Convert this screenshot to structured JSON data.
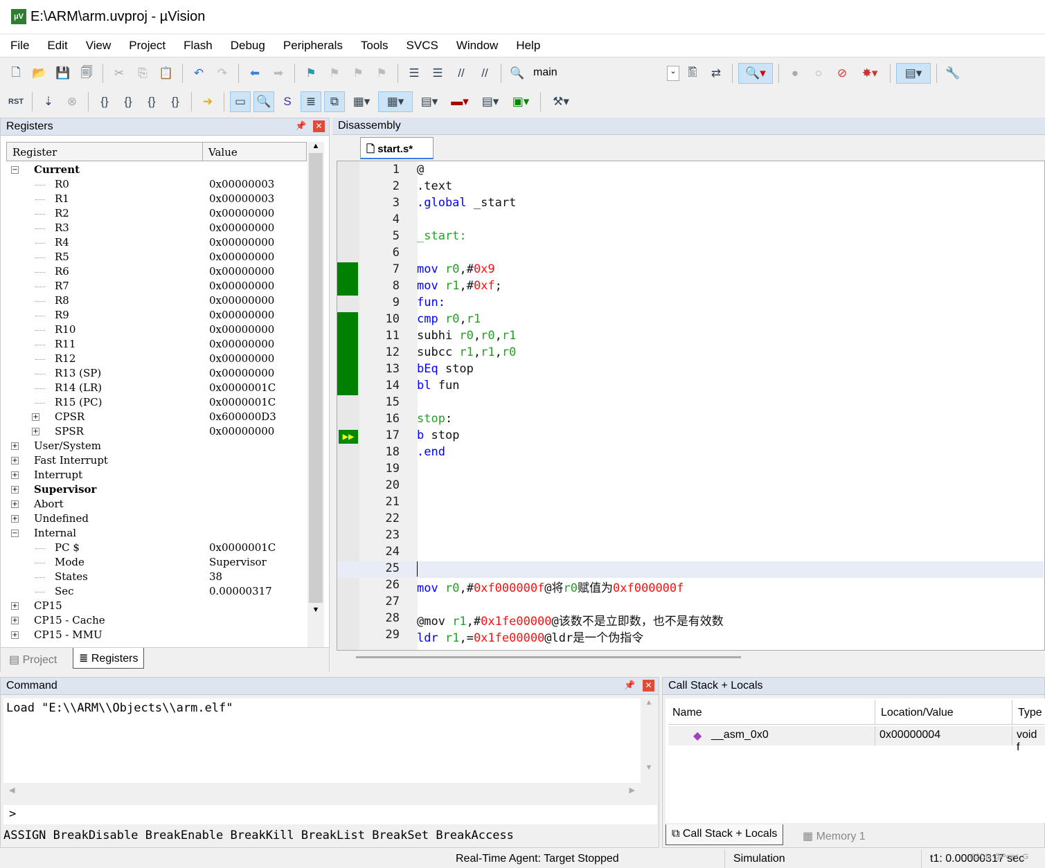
{
  "window": {
    "title": "E:\\ARM\\arm.uvproj - µVision",
    "icon": "uvision-icon"
  },
  "menu": [
    "File",
    "Edit",
    "View",
    "Project",
    "Flash",
    "Debug",
    "Peripherals",
    "Tools",
    "SVCS",
    "Window",
    "Help"
  ],
  "toolbar1": {
    "target_combo": "main"
  },
  "toolbar2": {
    "reset_label": "RST"
  },
  "registers": {
    "title": "Registers",
    "col_register": "Register",
    "col_value": "Value",
    "rows": [
      {
        "name": "Current",
        "value": "",
        "level": 0,
        "exp": "-",
        "bold": true
      },
      {
        "name": "R0",
        "value": "0x00000003",
        "level": 1
      },
      {
        "name": "R1",
        "value": "0x00000003",
        "level": 1
      },
      {
        "name": "R2",
        "value": "0x00000000",
        "level": 1
      },
      {
        "name": "R3",
        "value": "0x00000000",
        "level": 1
      },
      {
        "name": "R4",
        "value": "0x00000000",
        "level": 1
      },
      {
        "name": "R5",
        "value": "0x00000000",
        "level": 1
      },
      {
        "name": "R6",
        "value": "0x00000000",
        "level": 1
      },
      {
        "name": "R7",
        "value": "0x00000000",
        "level": 1
      },
      {
        "name": "R8",
        "value": "0x00000000",
        "level": 1
      },
      {
        "name": "R9",
        "value": "0x00000000",
        "level": 1
      },
      {
        "name": "R10",
        "value": "0x00000000",
        "level": 1
      },
      {
        "name": "R11",
        "value": "0x00000000",
        "level": 1
      },
      {
        "name": "R12",
        "value": "0x00000000",
        "level": 1
      },
      {
        "name": "R13 (SP)",
        "value": "0x00000000",
        "level": 1
      },
      {
        "name": "R14 (LR)",
        "value": "0x0000001C",
        "level": 1
      },
      {
        "name": "R15 (PC)",
        "value": "0x0000001C",
        "level": 1
      },
      {
        "name": "CPSR",
        "value": "0x600000D3",
        "level": 1,
        "exp": "+"
      },
      {
        "name": "SPSR",
        "value": "0x00000000",
        "level": 1,
        "exp": "+"
      },
      {
        "name": "User/System",
        "value": "",
        "level": 0,
        "exp": "+"
      },
      {
        "name": "Fast Interrupt",
        "value": "",
        "level": 0,
        "exp": "+"
      },
      {
        "name": "Interrupt",
        "value": "",
        "level": 0,
        "exp": "+"
      },
      {
        "name": "Supervisor",
        "value": "",
        "level": 0,
        "exp": "+",
        "bold": true
      },
      {
        "name": "Abort",
        "value": "",
        "level": 0,
        "exp": "+"
      },
      {
        "name": "Undefined",
        "value": "",
        "level": 0,
        "exp": "+"
      },
      {
        "name": "Internal",
        "value": "",
        "level": 0,
        "exp": "-"
      },
      {
        "name": "PC  $",
        "value": "0x0000001C",
        "level": 1
      },
      {
        "name": "Mode",
        "value": "Supervisor",
        "level": 1
      },
      {
        "name": "States",
        "value": "38",
        "level": 1
      },
      {
        "name": "Sec",
        "value": "0.00000317",
        "level": 1
      },
      {
        "name": "CP15",
        "value": "",
        "level": 0,
        "exp": "+"
      },
      {
        "name": "CP15 - Cache",
        "value": "",
        "level": 0,
        "exp": "+"
      },
      {
        "name": "CP15 - MMU",
        "value": "",
        "level": 0,
        "exp": "+"
      }
    ]
  },
  "left_tabs": [
    "Project",
    "Registers"
  ],
  "disassembly": {
    "title": "Disassembly",
    "file_tab": "start.s*",
    "lines": [
      {
        "n": "1",
        "tok": [
          [
            "@",
            "t"
          ]
        ]
      },
      {
        "n": "2",
        "tok": [
          [
            ".text",
            "t"
          ]
        ]
      },
      {
        "n": "3",
        "tok": [
          [
            ".global",
            "k"
          ],
          [
            " _start",
            "t"
          ]
        ]
      },
      {
        "n": "4",
        "tok": []
      },
      {
        "n": "5",
        "tok": [
          [
            "_start:",
            "r"
          ]
        ]
      },
      {
        "n": "6",
        "tok": []
      },
      {
        "n": "7",
        "tok": [
          [
            "mov",
            "k"
          ],
          [
            " ",
            "t"
          ],
          [
            "r0",
            "r"
          ],
          [
            ",#",
            "t"
          ],
          [
            "0x9",
            "n"
          ]
        ],
        "cov": true
      },
      {
        "n": "8",
        "tok": [
          [
            "mov",
            "k"
          ],
          [
            " ",
            "t"
          ],
          [
            "r1",
            "r"
          ],
          [
            ",#",
            "t"
          ],
          [
            "0xf",
            "n"
          ],
          [
            ";",
            "t"
          ]
        ],
        "cov": true
      },
      {
        "n": "9",
        "tok": [
          [
            "fun:",
            "k"
          ]
        ]
      },
      {
        "n": "10",
        "tok": [
          [
            "cmp",
            "k"
          ],
          [
            " ",
            "t"
          ],
          [
            "r0",
            "r"
          ],
          [
            ",",
            "t"
          ],
          [
            "r1",
            "r"
          ]
        ],
        "cov": true
      },
      {
        "n": "11",
        "tok": [
          [
            "subhi ",
            "t"
          ],
          [
            "r0",
            "r"
          ],
          [
            ",",
            "t"
          ],
          [
            "r0",
            "r"
          ],
          [
            ",",
            "t"
          ],
          [
            "r1",
            "r"
          ]
        ],
        "cov": true
      },
      {
        "n": "12",
        "tok": [
          [
            "subcc ",
            "t"
          ],
          [
            "r1",
            "r"
          ],
          [
            ",",
            "t"
          ],
          [
            "r1",
            "r"
          ],
          [
            ",",
            "t"
          ],
          [
            "r0",
            "r"
          ]
        ],
        "cov": true
      },
      {
        "n": "13",
        "tok": [
          [
            "bEq",
            "k"
          ],
          [
            " stop",
            "t"
          ]
        ],
        "cov": true
      },
      {
        "n": "14",
        "tok": [
          [
            "bl",
            "k"
          ],
          [
            " fun",
            "t"
          ]
        ],
        "cov": true
      },
      {
        "n": "15",
        "tok": []
      },
      {
        "n": "16",
        "tok": [
          [
            "stop",
            "r"
          ],
          [
            ":",
            "t"
          ]
        ]
      },
      {
        "n": "17",
        "tok": [
          [
            "b",
            "k"
          ],
          [
            " stop",
            "t"
          ]
        ],
        "pc": true
      },
      {
        "n": "18",
        "tok": [
          [
            ".end",
            "k"
          ]
        ]
      },
      {
        "n": "19",
        "tok": []
      },
      {
        "n": "20",
        "tok": []
      },
      {
        "n": "21",
        "tok": []
      },
      {
        "n": "22",
        "tok": []
      },
      {
        "n": "23",
        "tok": []
      },
      {
        "n": "24",
        "tok": []
      },
      {
        "n": "25",
        "tok": [],
        "cur": true
      },
      {
        "n": "26",
        "tok": [
          [
            "mov",
            "k"
          ],
          [
            " ",
            "t"
          ],
          [
            "r0",
            "r"
          ],
          [
            ",#",
            "t"
          ],
          [
            "0xf000000f",
            "n"
          ],
          [
            "@将",
            "t"
          ],
          [
            "r0",
            "r"
          ],
          [
            "赋值为",
            "t"
          ],
          [
            "0xf000000f",
            "n"
          ]
        ]
      },
      {
        "n": "27",
        "tok": []
      },
      {
        "n": "28",
        "tok": [
          [
            "@mov ",
            "t"
          ],
          [
            "r1",
            "r"
          ],
          [
            ",#",
            "t"
          ],
          [
            "0x1fe00000",
            "n"
          ],
          [
            "@该数不是立即数，也不是有效数",
            "t"
          ]
        ]
      },
      {
        "n": "29",
        "tok": [
          [
            "ldr",
            "k"
          ],
          [
            " ",
            "t"
          ],
          [
            "r1",
            "r"
          ],
          [
            ",=",
            "t"
          ],
          [
            "0x1fe00000",
            "n"
          ],
          [
            "@ldr是一个伪指令",
            "t"
          ]
        ]
      }
    ]
  },
  "command": {
    "title": "Command",
    "output": "Load \"E:\\\\ARM\\\\Objects\\\\arm.elf\"",
    "prompt": ">",
    "hints": "ASSIGN BreakDisable BreakEnable BreakKill BreakList BreakSet BreakAccess"
  },
  "callstack": {
    "title": "Call Stack + Locals",
    "cols": [
      "Name",
      "Location/Value",
      "Type"
    ],
    "rows": [
      {
        "name": "__asm_0x0",
        "value": "0x00000004",
        "type": "void f"
      }
    ],
    "tabs": [
      "Call Stack + Locals",
      "Memory 1"
    ]
  },
  "status": {
    "agent": "Real-Time Agent: Target Stopped",
    "mode": "Simulation",
    "time": "t1: 0.00000317 sec",
    "watermark": "CSDN @Point_G"
  },
  "colors": {
    "coverage": "#008000",
    "keyword": "#0000ff",
    "register": "#22a022",
    "number": "#ff1010"
  }
}
